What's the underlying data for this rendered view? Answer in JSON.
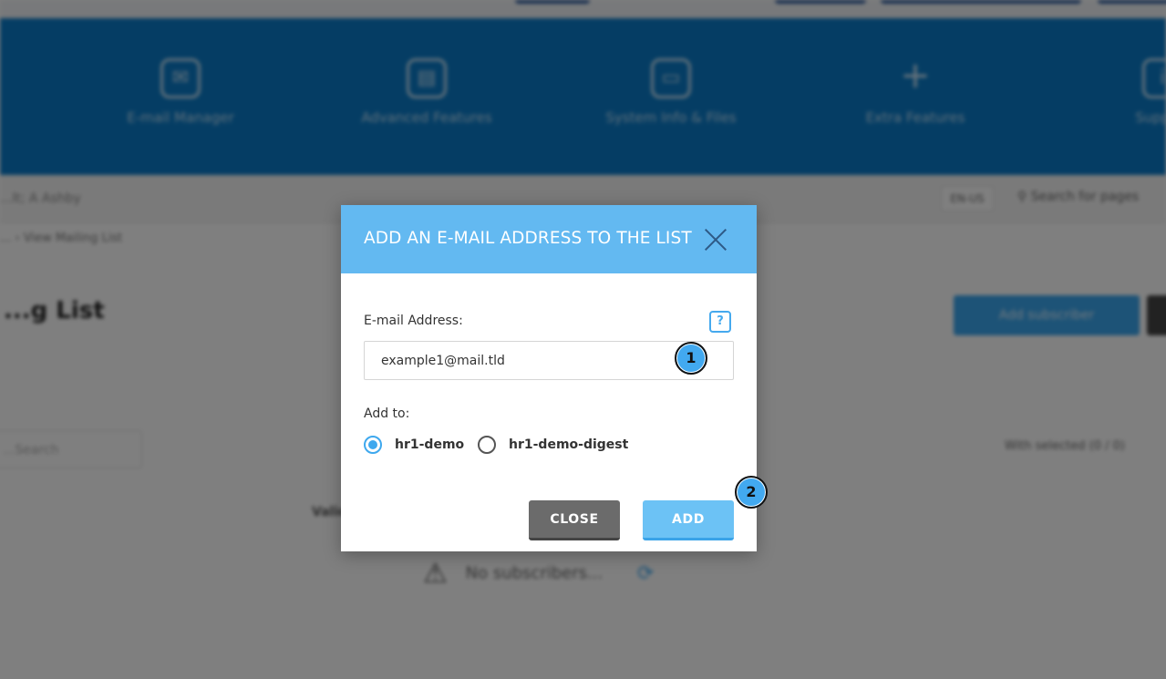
{
  "background": {
    "nav_items": [
      {
        "label": "E-mail Manager",
        "icon": "envelope-icon"
      },
      {
        "label": "Advanced Features",
        "icon": "document-icon"
      },
      {
        "label": "System Info & Files",
        "icon": "folder-icon"
      },
      {
        "label": "Extra Features",
        "icon": "plus-icon"
      },
      {
        "label": "Support",
        "icon": "support-icon"
      }
    ],
    "account_text": "...lt; A Ashby",
    "language": "EN-US",
    "search_placeholder": "Search for pages",
    "breadcrumb": "... › View Mailing List",
    "page_title": "...g List",
    "add_subscriber_label": "Add subscriber",
    "filter_placeholder": "...Search",
    "selection_text": "With selected (0 / 0)",
    "column_header": "Valid",
    "empty_text": "No subscribers..."
  },
  "modal": {
    "title": "ADD AN E-MAIL ADDRESS TO THE LIST",
    "email_label": "E-mail Address:",
    "help_text": "?",
    "email_value": "example1@mail.tld",
    "add_to_label": "Add to:",
    "lists": [
      {
        "label": "hr1-demo",
        "checked": true
      },
      {
        "label": "hr1-demo-digest",
        "checked": false
      }
    ],
    "close_label": "CLOSE",
    "add_label": "ADD"
  },
  "markers": [
    "1",
    "2"
  ],
  "colors": {
    "header": "#63b9f1",
    "accent": "#3ea8ee",
    "close_button": "#6b6b6b",
    "add_button": "#6cc2f5"
  }
}
